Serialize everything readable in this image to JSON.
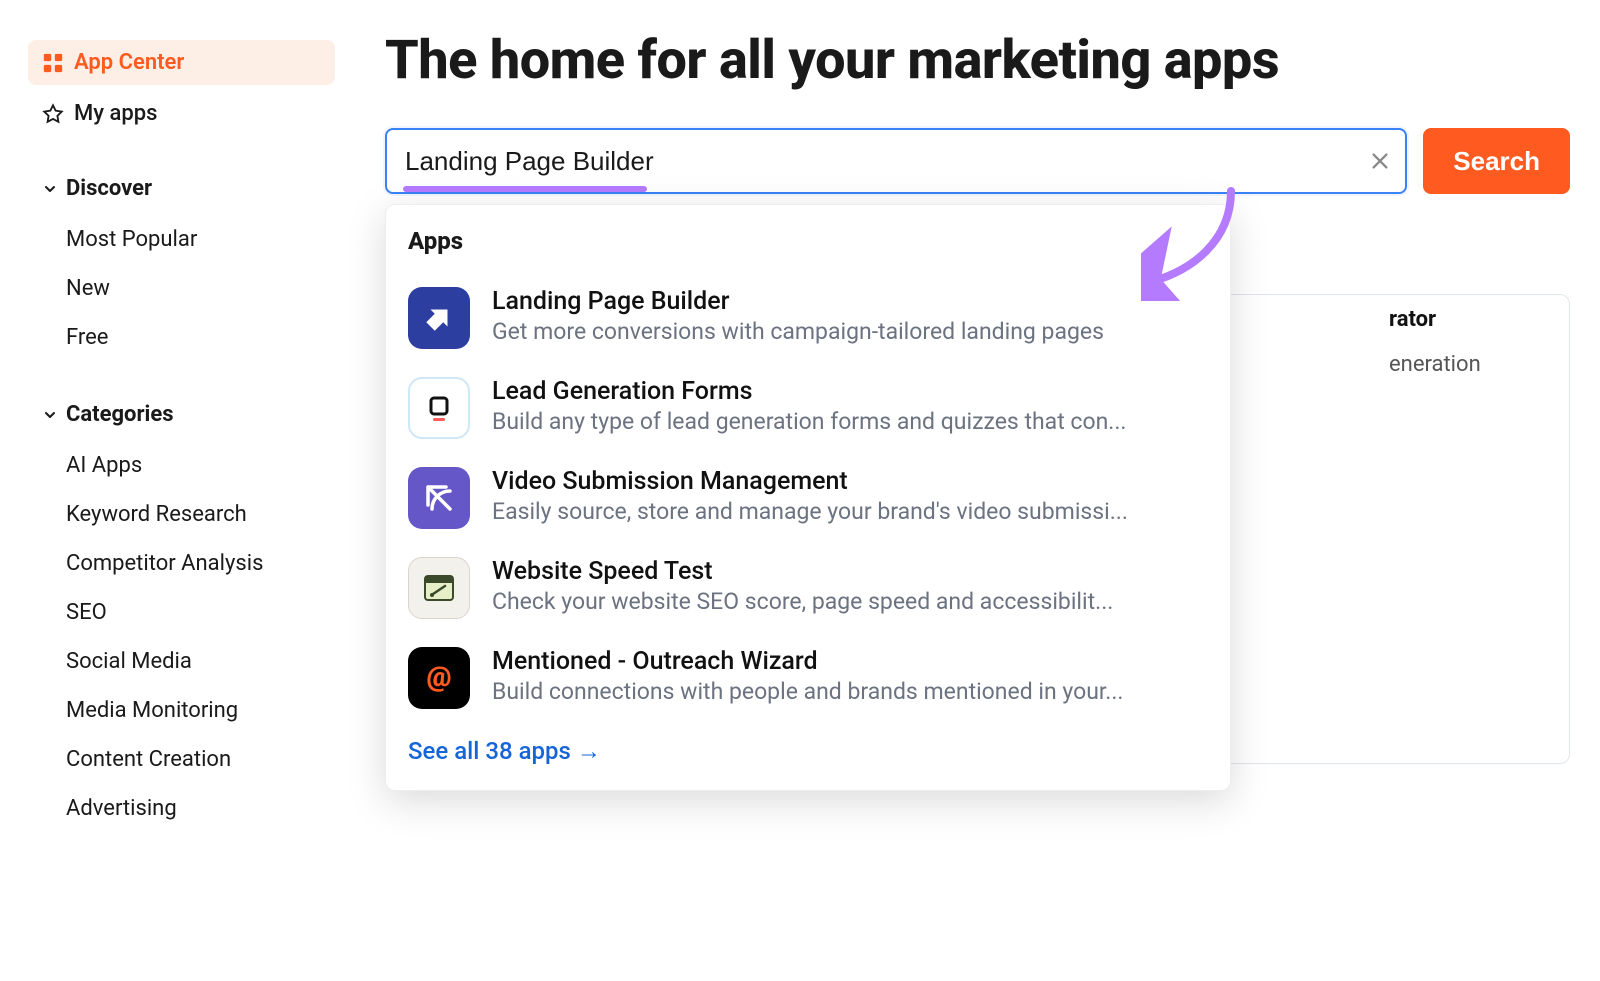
{
  "sidebar": {
    "app_center": "App Center",
    "my_apps": "My apps",
    "discover": {
      "heading": "Discover",
      "items": [
        "Most Popular",
        "New",
        "Free"
      ]
    },
    "categories": {
      "heading": "Categories",
      "items": [
        "AI Apps",
        "Keyword Research",
        "Competitor Analysis",
        "SEO",
        "Social Media",
        "Media Monitoring",
        "Content Creation",
        "Advertising"
      ]
    }
  },
  "main": {
    "title": "The home for all your marketing apps",
    "search_value": "Landing Page Builder",
    "search_button": "Search"
  },
  "bg": {
    "right_title_fragment": "rator",
    "right_sub_fragment": "eneration"
  },
  "dropdown": {
    "heading": "Apps",
    "apps": [
      {
        "title": "Landing Page Builder",
        "desc": "Get more conversions with campaign-tailored landing pages"
      },
      {
        "title": "Lead Generation Forms",
        "desc": "Build any type of lead generation forms and quizzes that con..."
      },
      {
        "title": "Video Submission Management",
        "desc": "Easily source, store and manage your brand's video submissi..."
      },
      {
        "title": "Website Speed Test",
        "desc": "Check your website SEO score, page speed and accessibilit..."
      },
      {
        "title": "Mentioned - Outreach Wizard",
        "desc": "Build connections with people and brands mentioned in your..."
      }
    ],
    "see_all": "See all 38 apps →"
  }
}
